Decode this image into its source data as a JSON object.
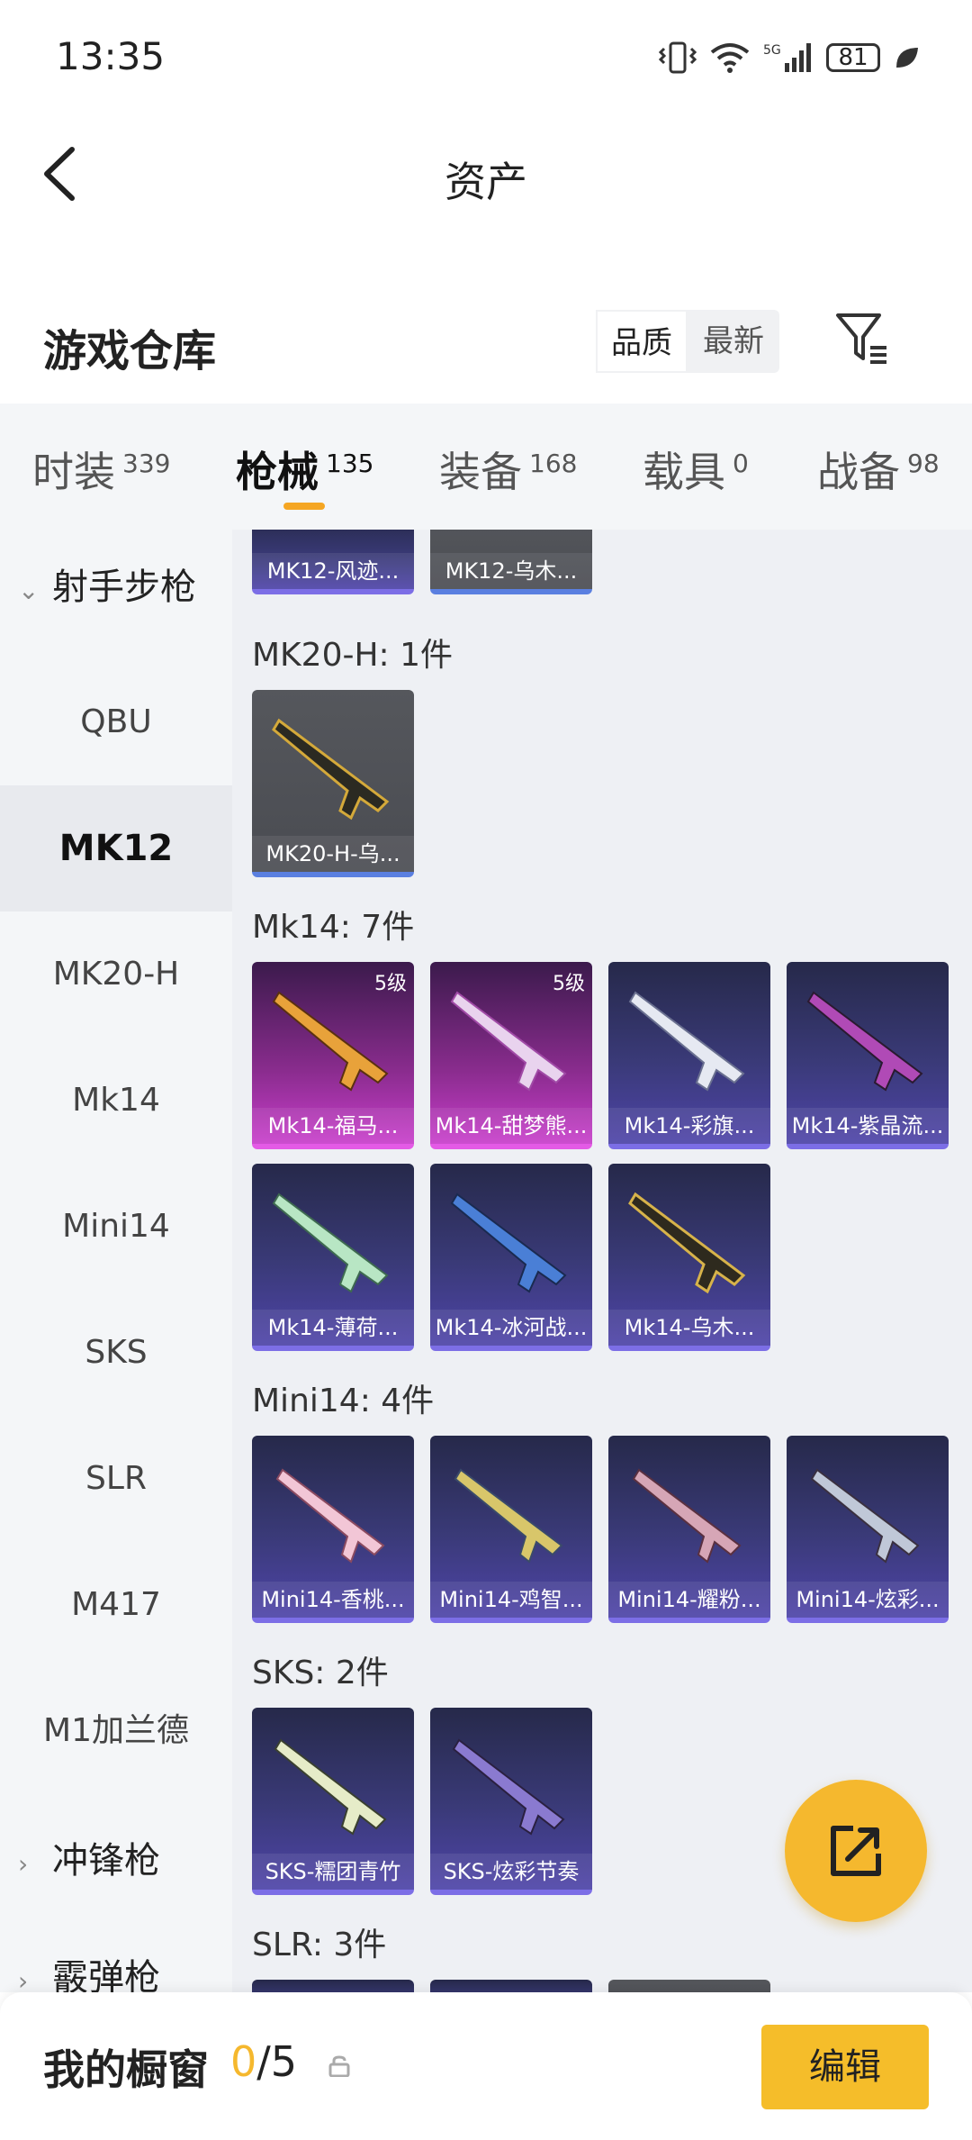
{
  "status": {
    "time": "13:35",
    "battery": "81"
  },
  "nav": {
    "title": "资产"
  },
  "warehouse": {
    "title": "游戏仓库",
    "sort_quality": "品质",
    "sort_newest": "最新"
  },
  "tabs": [
    {
      "label": "时装",
      "count": "339"
    },
    {
      "label": "枪械",
      "count": "135"
    },
    {
      "label": "装备",
      "count": "168"
    },
    {
      "label": "载具",
      "count": "0"
    },
    {
      "label": "战备",
      "count": "98"
    }
  ],
  "sidebar": {
    "category_expanded": "射手步枪",
    "items": [
      "QBU",
      "MK12",
      "MK20-H",
      "Mk14",
      "Mini14",
      "SKS",
      "SLR",
      "M417",
      "M1加兰德"
    ],
    "category_smg": "冲锋枪",
    "category_shotgun": "霰弹枪"
  },
  "groups": {
    "mk12_partial": [
      "MK12-风迹...",
      "MK12-乌木..."
    ],
    "mk20": {
      "title": "MK20-H: 1件",
      "items": [
        "MK20-H-乌..."
      ]
    },
    "mk14": {
      "title": "Mk14: 7件",
      "items": [
        "Mk14-福马...",
        "Mk14-甜梦熊...",
        "Mk14-彩旗...",
        "Mk14-紫晶流...",
        "Mk14-薄荷...",
        "Mk14-冰河战...",
        "Mk14-乌木..."
      ],
      "level": "5级"
    },
    "mini14": {
      "title": "Mini14: 4件",
      "items": [
        "Mini14-香桃...",
        "Mini14-鸡智...",
        "Mini14-耀粉...",
        "Mini14-炫彩..."
      ]
    },
    "sks": {
      "title": "SKS: 2件",
      "items": [
        "SKS-糯团青竹",
        "SKS-炫彩节奏"
      ]
    },
    "slr": {
      "title": "SLR: 3件"
    }
  },
  "bottom": {
    "title": "我的橱窗",
    "current": "0",
    "total": "/5",
    "edit": "编辑"
  },
  "colors": {
    "accent": "#f5b82e",
    "purple_card": "#3a3a78",
    "pink_card": "#c83ecb"
  }
}
